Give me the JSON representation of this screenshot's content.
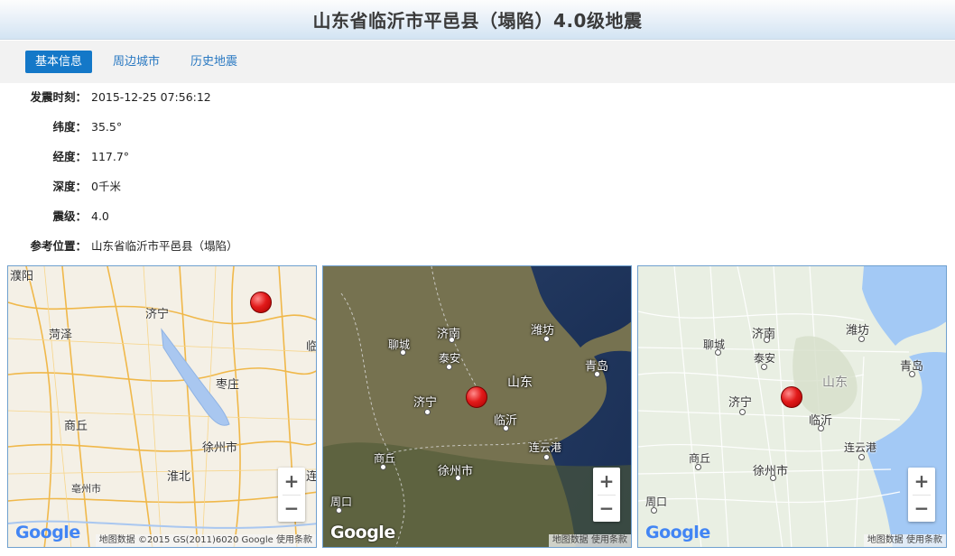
{
  "header": {
    "title": "山东省临沂市平邑县（塌陷）4.0级地震"
  },
  "tabs": [
    {
      "label": "基本信息",
      "active": true
    },
    {
      "label": "周边城市",
      "active": false
    },
    {
      "label": "历史地震",
      "active": false
    }
  ],
  "info": [
    {
      "label": "发震时刻：",
      "value": "2015-12-25 07:56:12"
    },
    {
      "label": "纬度：",
      "value": "35.5°"
    },
    {
      "label": "经度：",
      "value": "117.7°"
    },
    {
      "label": "深度：",
      "value": "0千米"
    },
    {
      "label": "震级：",
      "value": "4.0"
    },
    {
      "label": "参考位置：",
      "value": "山东省临沂市平邑县（塌陷）"
    }
  ],
  "maps": {
    "zoom_in": "+",
    "zoom_out": "−",
    "logo": "Google",
    "map1": {
      "attribution": "地图数据 ©2015 GS(2011)6020 Google   使用条款",
      "cities": [
        "濮阳",
        "济宁",
        "菏泽",
        "枣庄",
        "商丘",
        "徐州市",
        "淮北",
        "亳州市",
        "临",
        "连"
      ]
    },
    "map2": {
      "attribution": "地图数据  使用条款",
      "cities": [
        "济南",
        "潍坊",
        "聊城",
        "泰安",
        "山东",
        "青岛",
        "济宁",
        "临沂",
        "连云港",
        "商丘",
        "徐州市",
        "周口"
      ]
    },
    "map3": {
      "attribution": "地图数据  使用条款",
      "cities": [
        "济南",
        "潍坊",
        "聊城",
        "泰安",
        "山东",
        "青岛",
        "济宁",
        "临沂",
        "连云港",
        "商丘",
        "徐州市",
        "周口"
      ]
    }
  },
  "colors": {
    "accent": "#1478c8",
    "link": "#2a79c2",
    "pin": "#e21a1a",
    "map_border": "#6fa0cf"
  }
}
